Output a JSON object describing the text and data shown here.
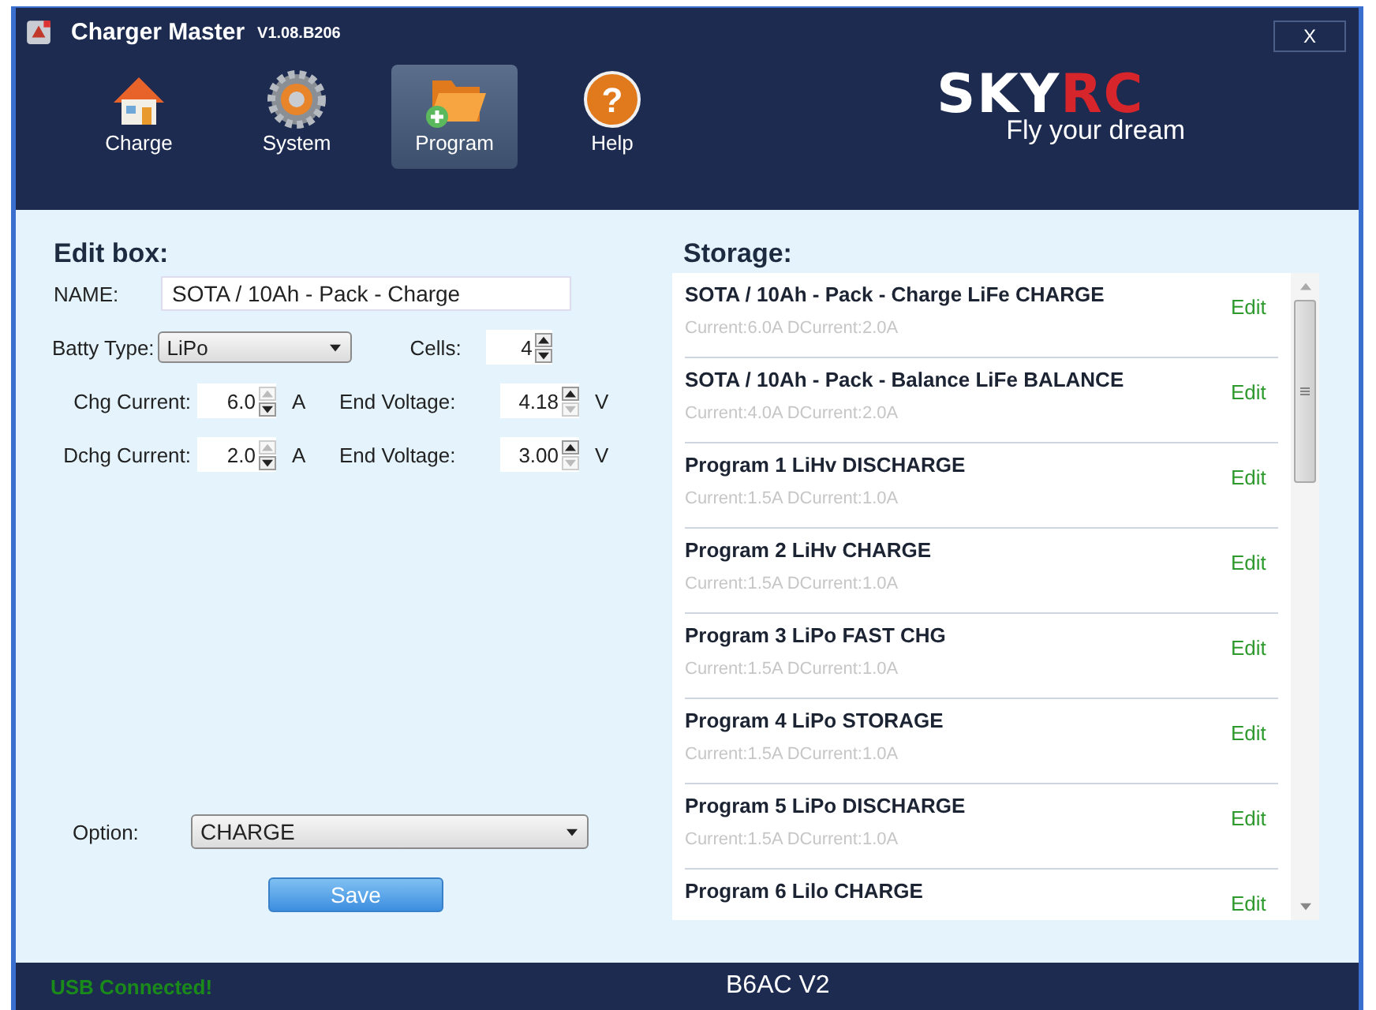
{
  "window": {
    "title": "Charger Master",
    "version": "V1.08.B206",
    "close": "X"
  },
  "toolbar": [
    {
      "label": "Charge",
      "kind": "house",
      "selected": false
    },
    {
      "label": "System",
      "kind": "gear",
      "selected": false
    },
    {
      "label": "Program",
      "kind": "folder",
      "selected": true
    },
    {
      "label": "Help",
      "kind": "help",
      "icon_text": "?",
      "selected": false
    }
  ],
  "logo": {
    "brand_white": "SKY",
    "brand_red": "RC",
    "tagline": "Fly your dream"
  },
  "edit_box": {
    "title": "Edit box:",
    "name_label": "NAME:",
    "name_value": "SOTA / 10Ah - Pack - Charge",
    "batt_type_label": "Batty Type:",
    "batt_type_value": "LiPo",
    "cells_label": "Cells:",
    "cells_value": "4",
    "rows": [
      {
        "current_label": "Chg Current:",
        "current_value": "6.0",
        "current_up_disabled": true,
        "current_unit": "A",
        "voltage_label": "End Voltage:",
        "voltage_value": "4.18",
        "voltage_down_disabled": true,
        "voltage_unit": "V"
      },
      {
        "current_label": "Dchg Current:",
        "current_value": "2.0",
        "current_up_disabled": true,
        "current_unit": "A",
        "voltage_label": "End Voltage:",
        "voltage_value": "3.00",
        "voltage_down_disabled": true,
        "voltage_unit": "V"
      }
    ],
    "option_label": "Option:",
    "option_value": "CHARGE",
    "save": "Save"
  },
  "storage": {
    "title": "Storage:",
    "items": [
      {
        "name": "SOTA / 10Ah - Pack - Charge LiFe CHARGE",
        "detail": "Current:6.0A  DCurrent:2.0A",
        "edit": "Edit"
      },
      {
        "name": "SOTA / 10Ah - Pack - Balance LiFe BALANCE",
        "detail": "Current:4.0A  DCurrent:2.0A",
        "edit": "Edit"
      },
      {
        "name": "Program 1 LiHv DISCHARGE",
        "detail": "Current:1.5A  DCurrent:1.0A",
        "edit": "Edit"
      },
      {
        "name": "Program 2 LiHv CHARGE",
        "detail": "Current:1.5A  DCurrent:1.0A",
        "edit": "Edit"
      },
      {
        "name": "Program 3 LiPo FAST CHG",
        "detail": "Current:1.5A  DCurrent:1.0A",
        "edit": "Edit"
      },
      {
        "name": "Program 4 LiPo STORAGE",
        "detail": "Current:1.5A  DCurrent:1.0A",
        "edit": "Edit"
      },
      {
        "name": "Program 5  LiPo DISCHARGE",
        "detail": "Current:1.5A  DCurrent:1.0A",
        "edit": "Edit"
      },
      {
        "name": "Program 6 Lilo CHARGE",
        "edit": "Edit"
      }
    ]
  },
  "status_bar": {
    "connection": "USB  Connected!",
    "device": "B6AC V2"
  }
}
